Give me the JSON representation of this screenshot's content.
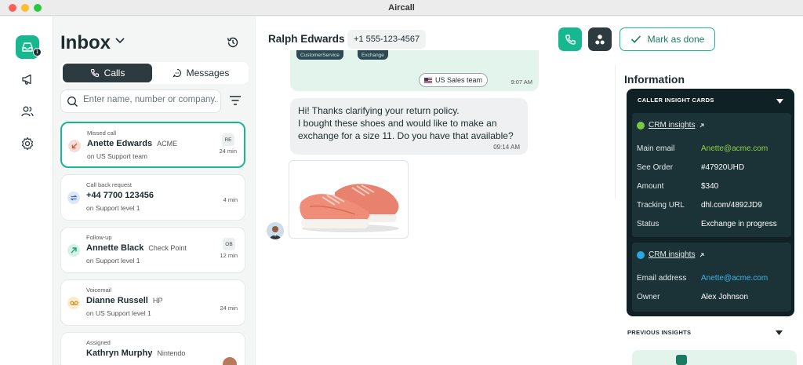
{
  "window": {
    "title": "Aircall"
  },
  "rail": {
    "badge": "1"
  },
  "inbox": {
    "title": "Inbox",
    "tabs": {
      "calls": "Calls",
      "messages": "Messages"
    },
    "search_placeholder": "Enter name, number or company...",
    "cards": [
      {
        "type": "Missed call",
        "name": "Anette Edwards",
        "company": "ACME",
        "sub": "on  US Support team",
        "initials": "RE",
        "time": "24 min",
        "icon": "missed-call-icon",
        "color": "#f3ddd6"
      },
      {
        "type": "Call back request",
        "name": "+44 7700 123456",
        "company": "",
        "sub": "on  Support level 1",
        "initials": "",
        "time": "4 min",
        "icon": "callback-icon",
        "color": "#dde7f5"
      },
      {
        "type": "Follow-up",
        "name": "Annette Black",
        "company": "Check Point",
        "sub": "on  Support level 1",
        "initials": "OB",
        "time": "12 min",
        "icon": "follow-up-icon",
        "color": "#d6f0e6"
      },
      {
        "type": "Voicemail",
        "name": "Dianne Russell",
        "company": "HP",
        "sub": "on  US Support level 1",
        "initials": "",
        "time": "24 min",
        "icon": "voicemail-icon",
        "color": "#fbecd0"
      },
      {
        "type": "Assigned",
        "name": "Kathryn Murphy",
        "company": "Nintendo",
        "sub": "",
        "initials": "",
        "time": "",
        "icon": "assigned-icon",
        "color": "#e6e9ea"
      }
    ]
  },
  "conversation": {
    "contact_name": "Ralph Edwards",
    "contact_phone": "+1 555-123-4567",
    "mark_done_label": "Mark as done",
    "top_message": {
      "tags": [
        "CustomerService",
        "Exchange"
      ],
      "team_pill": "US Sales team",
      "time": "9:07 AM"
    },
    "message": {
      "lines": [
        "Hi! Thanks clarifying your return policy.",
        "I bought these shoes and would like to make an",
        "exchange for a size 11. Do you have that available?"
      ],
      "time": "09:14 AM"
    }
  },
  "information": {
    "title": "Information",
    "caller_insight_header": "CALLER INSIGHT CARDS",
    "crm_cards": [
      {
        "title": "CRM insights",
        "dot_color": "#7ac943",
        "rows": [
          {
            "label": "Main email",
            "value": "Anette@acme.com"
          },
          {
            "label": "See Order",
            "value": "#47920UHD"
          },
          {
            "label": "Amount",
            "value": "$340"
          },
          {
            "label": "Tracking URL",
            "value": "dhl.com/4892JD9"
          },
          {
            "label": "Status",
            "value": "Exchange in progress"
          }
        ]
      },
      {
        "title": "CRM insights",
        "dot_color": "#29a8e0",
        "rows": [
          {
            "label": "Email address",
            "value": "Anette@acme.com"
          },
          {
            "label": "Owner",
            "value": "Alex Johnson"
          }
        ]
      }
    ],
    "previous_insights": "PREVIOUS INSIGHTS"
  },
  "colors": {
    "brand": "#17b890",
    "dark": "#2d3b40",
    "insight_bg": "#0f2124"
  }
}
